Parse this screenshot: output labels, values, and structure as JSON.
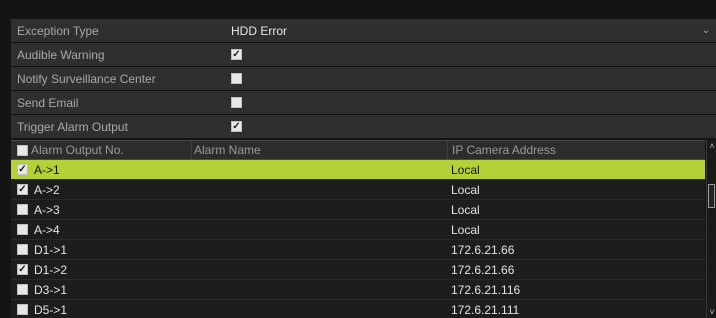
{
  "settings": {
    "exception_type_label": "Exception Type",
    "exception_type_value": "HDD Error",
    "audible_warning_label": "Audible Warning",
    "audible_warning_checked": true,
    "notify_center_label": "Notify Surveillance Center",
    "notify_center_checked": false,
    "send_email_label": "Send Email",
    "send_email_checked": false,
    "trigger_alarm_label": "Trigger Alarm Output",
    "trigger_alarm_checked": true
  },
  "table": {
    "columns": [
      "Alarm Output No.",
      "Alarm Name",
      "IP Camera Address"
    ],
    "rows": [
      {
        "no": "A->1",
        "name": "",
        "ip": "Local",
        "checked": true,
        "selected": true
      },
      {
        "no": "A->2",
        "name": "",
        "ip": "Local",
        "checked": true,
        "selected": false
      },
      {
        "no": "A->3",
        "name": "",
        "ip": "Local",
        "checked": false,
        "selected": false
      },
      {
        "no": "A->4",
        "name": "",
        "ip": "Local",
        "checked": false,
        "selected": false
      },
      {
        "no": "D1->1",
        "name": "",
        "ip": "172.6.21.66",
        "checked": false,
        "selected": false
      },
      {
        "no": "D1->2",
        "name": "",
        "ip": "172.6.21.66",
        "checked": true,
        "selected": false
      },
      {
        "no": "D3->1",
        "name": "",
        "ip": "172.6.21.116",
        "checked": false,
        "selected": false
      },
      {
        "no": "D5->1",
        "name": "",
        "ip": "172.6.21.111",
        "checked": false,
        "selected": false
      }
    ]
  },
  "icons": {
    "dropdown": "chevron-down-icon",
    "scroll_up": "chevron-up-icon",
    "scroll_down": "chevron-down-icon"
  }
}
